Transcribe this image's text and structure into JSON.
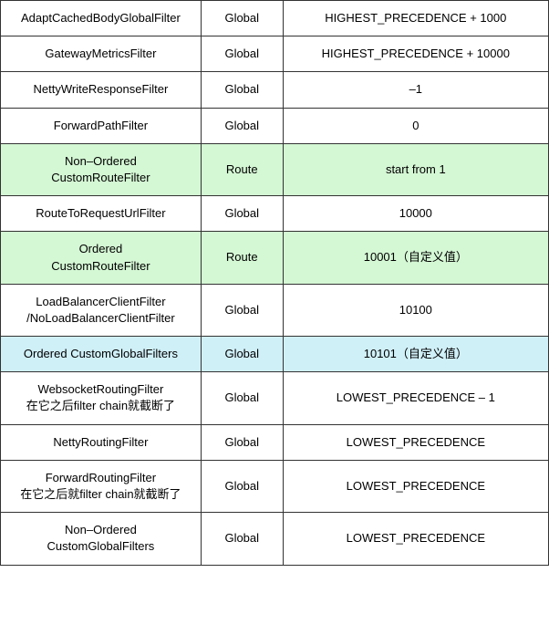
{
  "table": {
    "rows": [
      {
        "name": "AdaptCachedBodyGlobalFilter",
        "scope": "Global",
        "order": "HIGHEST_PRECEDENCE + 1000",
        "bg": ""
      },
      {
        "name": "GatewayMetricsFilter",
        "scope": "Global",
        "order": "HIGHEST_PRECEDENCE + 10000",
        "bg": ""
      },
      {
        "name": "NettyWriteResponseFilter",
        "scope": "Global",
        "order": "–1",
        "bg": ""
      },
      {
        "name": "ForwardPathFilter",
        "scope": "Global",
        "order": "0",
        "bg": ""
      },
      {
        "name": "Non–Ordered\nCustomRouteFilter",
        "scope": "Route",
        "order": "start from 1",
        "bg": "green"
      },
      {
        "name": "RouteToRequestUrlFilter",
        "scope": "Global",
        "order": "10000",
        "bg": ""
      },
      {
        "name": "Ordered\nCustomRouteFilter",
        "scope": "Route",
        "order": "10001（自定义值）",
        "bg": "green"
      },
      {
        "name": "LoadBalancerClientFilter\n/NoLoadBalancerClientFilter",
        "scope": "Global",
        "order": "10100",
        "bg": ""
      },
      {
        "name": "Ordered CustomGlobalFilters",
        "scope": "Global",
        "order": "10101（自定义值）",
        "bg": "cyan"
      },
      {
        "name": "WebsocketRoutingFilter\n在它之后filter chain就截断了",
        "scope": "Global",
        "order": "LOWEST_PRECEDENCE – 1",
        "bg": ""
      },
      {
        "name": "NettyRoutingFilter",
        "scope": "Global",
        "order": "LOWEST_PRECEDENCE",
        "bg": ""
      },
      {
        "name": "ForwardRoutingFilter\n在它之后就filter chain就截断了",
        "scope": "Global",
        "order": "LOWEST_PRECEDENCE",
        "bg": ""
      },
      {
        "name": "Non–Ordered\nCustomGlobalFilters",
        "scope": "Global",
        "order": "LOWEST_PRECEDENCE",
        "bg": ""
      }
    ]
  }
}
